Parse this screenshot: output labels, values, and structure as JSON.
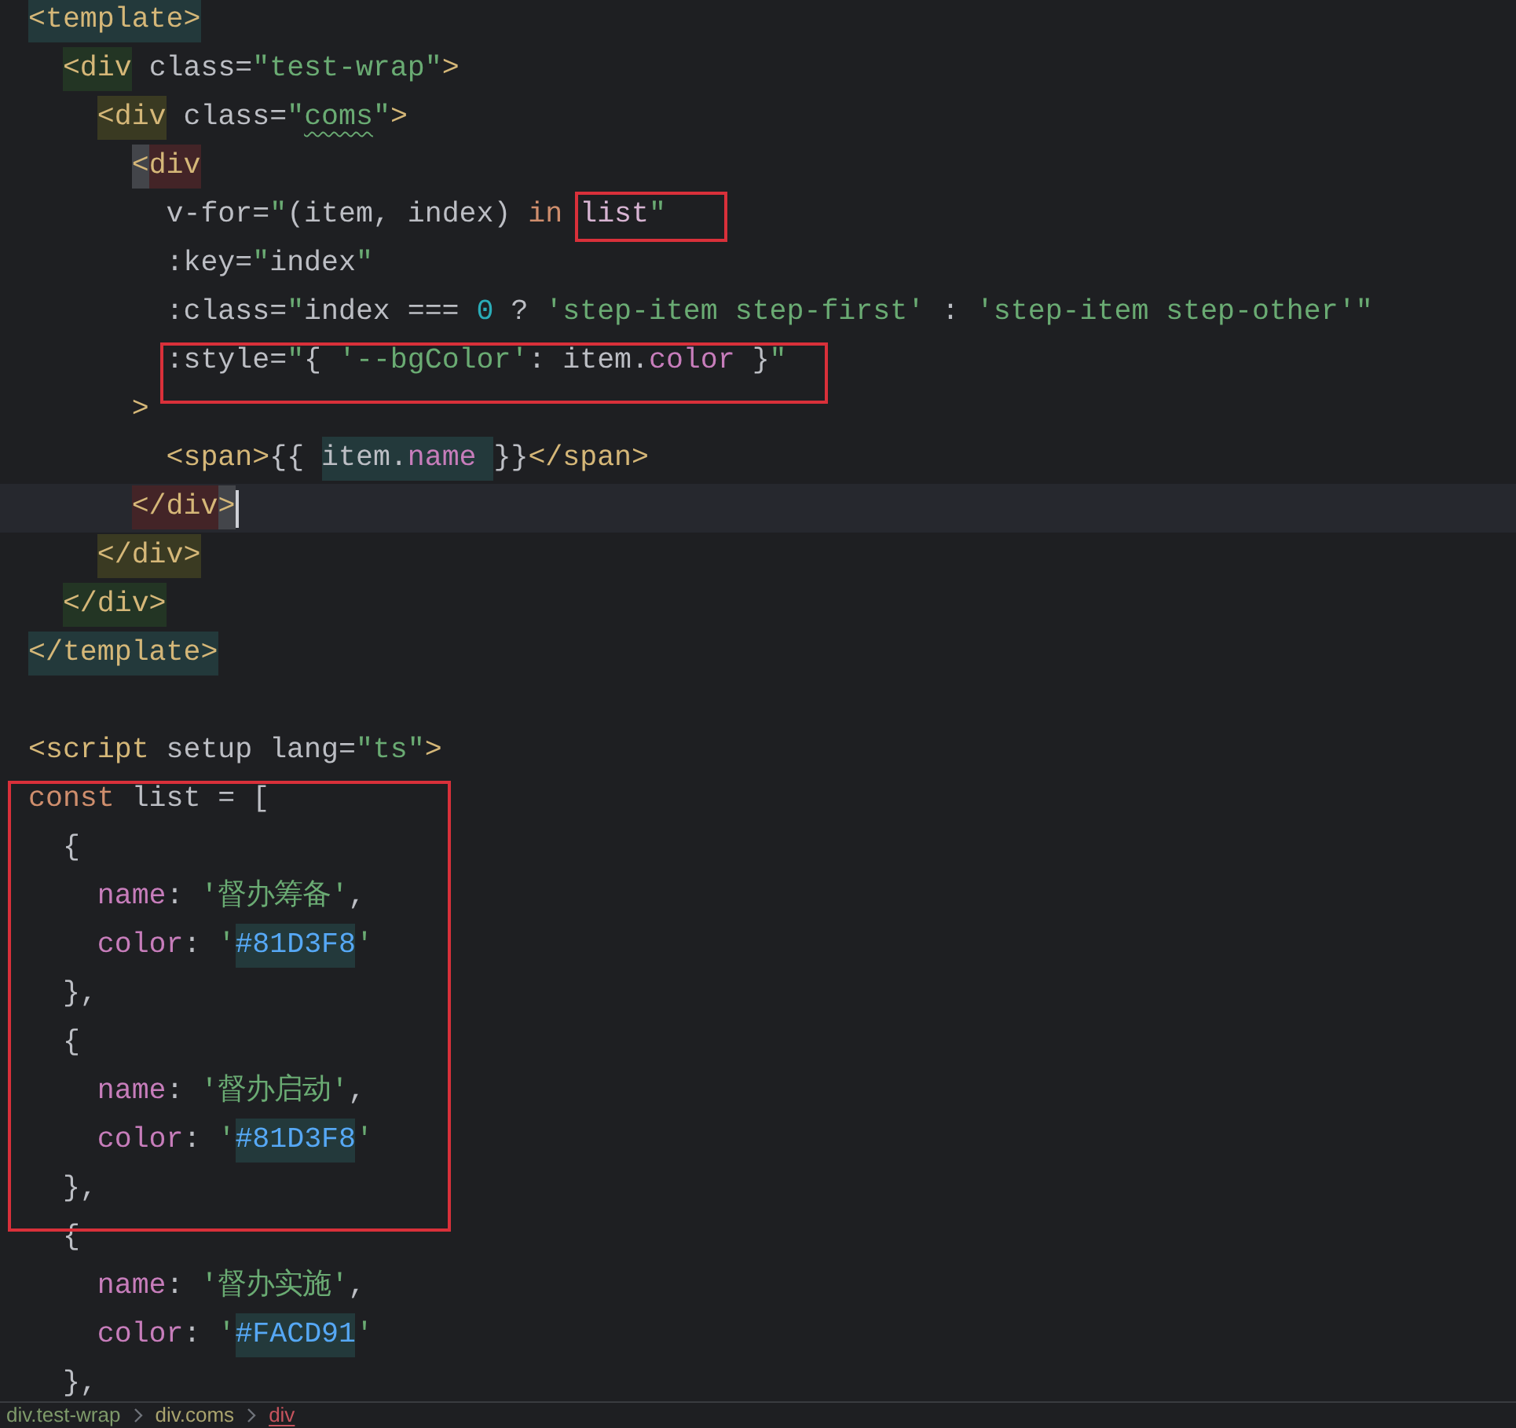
{
  "editor": {
    "blocks": [
      {
        "lines": [
          {
            "tokens": [
              {
                "kind": "tag",
                "text": "<template>",
                "color": "#23393b"
              }
            ]
          },
          {
            "tokens": [
              {
                "kind": "tag",
                "text": "  <div",
                "color": "#233524"
              },
              {
                "kind": "attr",
                "text": " class="
              },
              {
                "kind": "str",
                "text": "\"test-wrap\""
              },
              {
                "kind": "tag",
                "text": ">"
              }
            ]
          },
          {
            "tokens": [
              {
                "kind": "tag",
                "text": "    <div",
                "color": "#3a3a22"
              },
              {
                "kind": "attr",
                "text": " class="
              },
              {
                "kind": "str",
                "text": "\""
              },
              {
                "kind": "str",
                "text": "coms",
                "typo": true
              },
              {
                "kind": "str",
                "text": "\""
              },
              {
                "kind": "tag",
                "text": ">"
              }
            ]
          },
          {
            "tokens": [
              {
                "kind": "tag",
                "text": "      <",
                "color": "#43454a"
              },
              {
                "kind": "tag",
                "text": "div",
                "color": "#432427"
              }
            ]
          },
          {
            "tokens": [
              {
                "kind": "attr",
                "text": "        v-for="
              },
              {
                "kind": "str",
                "text": "\""
              },
              {
                "kind": "plain",
                "text": "(item, index) "
              },
              {
                "kind": "kw",
                "text": "in "
              },
              {
                "kind": "var",
                "text": "list",
                "boxed": true
              },
              {
                "kind": "str",
                "text": "\""
              }
            ]
          },
          {
            "tokens": [
              {
                "kind": "attr",
                "text": "        :key="
              },
              {
                "kind": "str",
                "text": "\""
              },
              {
                "kind": "plain",
                "text": "index"
              },
              {
                "kind": "str",
                "text": "\""
              }
            ]
          },
          {
            "tokens": [
              {
                "kind": "attr",
                "text": "        :class="
              },
              {
                "kind": "str",
                "text": "\""
              },
              {
                "kind": "plain",
                "text": "index === "
              },
              {
                "kind": "num",
                "text": "0"
              },
              {
                "kind": "plain",
                "text": " ? "
              },
              {
                "kind": "str",
                "text": "'step-item step-first'"
              },
              {
                "kind": "plain",
                "text": " : "
              },
              {
                "kind": "str",
                "text": "'step-item step-other'"
              },
              {
                "kind": "str",
                "text": "\""
              }
            ]
          }
        ]
      },
      {
        "boxed": true,
        "lines": [
          {
            "tokens": [
              {
                "kind": "attr",
                "text": "        :style="
              },
              {
                "kind": "str",
                "text": "\""
              },
              {
                "kind": "plain",
                "text": "{ "
              },
              {
                "kind": "str",
                "text": "'--bgColor'"
              },
              {
                "kind": "plain",
                "text": ": item."
              },
              {
                "kind": "prop",
                "text": "color"
              },
              {
                "kind": "plain",
                "text": " }"
              },
              {
                "kind": "str",
                "text": "\""
              }
            ]
          }
        ]
      },
      {
        "lines": [
          {
            "tokens": [
              {
                "kind": "tag",
                "text": "      >"
              }
            ]
          },
          {
            "tokens": [
              {
                "kind": "tag",
                "text": "        <span>"
              },
              {
                "kind": "plain",
                "text": "{{"
              },
              {
                "kind": "plain",
                "text": " item.",
                "color": "#23393b"
              },
              {
                "kind": "prop",
                "text": "name ",
                "color": "#23393b"
              },
              {
                "kind": "plain",
                "text": "}}"
              },
              {
                "kind": "tag",
                "text": "</span>"
              }
            ]
          },
          {
            "current": true,
            "tokens": [
              {
                "kind": "tag",
                "text": "      </div",
                "color": "#432427"
              },
              {
                "kind": "tag",
                "text": ">",
                "color": "#43454a"
              }
            ]
          },
          {
            "current": false,
            "tokens": [
              {
                "kind": "tag",
                "text": "    </div>",
                "color": "#3a3a22"
              }
            ]
          },
          {
            "tokens": [
              {
                "kind": "tag",
                "text": "  </div>",
                "color": "#233524"
              }
            ]
          },
          {
            "tokens": [
              {
                "kind": "tag",
                "text": "</template>",
                "color": "#23393b"
              }
            ]
          },
          {
            "blank_line_before": true,
            "tokens": [
              {
                "kind": "tag",
                "text": "<script"
              },
              {
                "kind": "attr",
                "text": " setup lang="
              },
              {
                "kind": "str",
                "text": "\"ts\""
              },
              {
                "kind": "tag",
                "text": ">"
              }
            ]
          }
        ]
      },
      {
        "boxed": true,
        "lines": [
          {
            "tokens": [
              {
                "kind": "kw",
                "text": "const"
              },
              {
                "kind": "plain",
                "text": " list = ["
              }
            ]
          },
          {
            "tokens": [
              {
                "kind": "plain",
                "text": "  {"
              }
            ]
          },
          {
            "tokens": [
              {
                "kind": "prop",
                "text": "    name"
              },
              {
                "kind": "plain",
                "text": ": "
              },
              {
                "kind": "str",
                "text": "'督办筹备'"
              },
              {
                "kind": "plain",
                "text": ","
              }
            ]
          },
          {
            "tokens": [
              {
                "kind": "prop",
                "text": "    color"
              },
              {
                "kind": "plain",
                "text": ": "
              },
              {
                "kind": "str",
                "text": "'"
              },
              {
                "kind": "hex",
                "text": "#81D3F8",
                "color": "#23393b"
              },
              {
                "kind": "str",
                "text": "'"
              }
            ]
          },
          {
            "tokens": [
              {
                "kind": "plain",
                "text": "  },"
              }
            ]
          },
          {
            "tokens": [
              {
                "kind": "plain",
                "text": "  {"
              }
            ]
          },
          {
            "tokens": [
              {
                "kind": "prop",
                "text": "    name"
              },
              {
                "kind": "plain",
                "text": ": "
              },
              {
                "kind": "str",
                "text": "'督办启动'"
              },
              {
                "kind": "plain",
                "text": ","
              }
            ]
          },
          {
            "tokens": [
              {
                "kind": "prop",
                "text": "    color"
              },
              {
                "kind": "plain",
                "text": ": "
              },
              {
                "kind": "str",
                "text": "'"
              },
              {
                "kind": "hex",
                "text": "#81D3F8",
                "color": "#23393b"
              },
              {
                "kind": "str",
                "text": "'"
              }
            ]
          },
          {
            "tokens": [
              {
                "kind": "plain",
                "text": "  },"
              }
            ]
          }
        ]
      },
      {
        "lines": [
          {
            "tokens": [
              {
                "kind": "plain",
                "text": "  {"
              }
            ]
          },
          {
            "tokens": [
              {
                "kind": "prop",
                "text": "    name"
              },
              {
                "kind": "plain",
                "text": ": "
              },
              {
                "kind": "str",
                "text": "'督办实施'"
              },
              {
                "kind": "plain",
                "text": ","
              }
            ]
          },
          {
            "tokens": [
              {
                "kind": "prop",
                "text": "    color"
              },
              {
                "kind": "plain",
                "text": ": "
              },
              {
                "kind": "str",
                "text": "'"
              },
              {
                "kind": "hex",
                "text": "#FACD91",
                "color": "#23393b"
              },
              {
                "kind": "str",
                "text": "'"
              }
            ]
          },
          {
            "tokens": [
              {
                "kind": "plain",
                "text": "  },"
              }
            ]
          }
        ]
      }
    ]
  },
  "breadcrumb": [
    {
      "label": "div.test-wrap",
      "color": "#7e9a6a",
      "selected": false
    },
    {
      "label": "div.coms",
      "color": "#a9a36e",
      "selected": false
    },
    {
      "label": "div",
      "color": "#c7545e",
      "selected": true
    }
  ]
}
